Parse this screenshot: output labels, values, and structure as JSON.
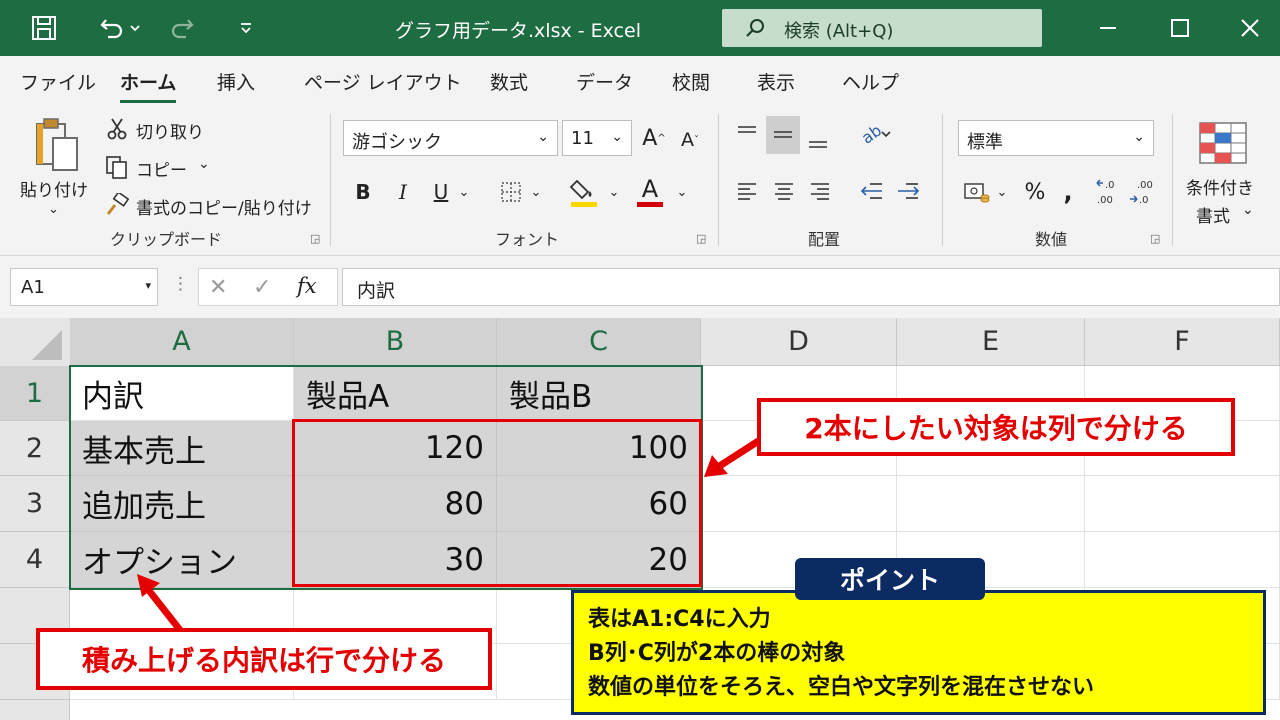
{
  "titlebar": {
    "title": "グラフ用データ.xlsx  -  Excel",
    "search_placeholder": "検索 (Alt+Q)",
    "accent": "#1e6c41"
  },
  "tabs": [
    {
      "label": "ファイル"
    },
    {
      "label": "ホーム"
    },
    {
      "label": "挿入"
    },
    {
      "label": "ページ レイアウト"
    },
    {
      "label": "数式"
    },
    {
      "label": "データ"
    },
    {
      "label": "校閲"
    },
    {
      "label": "表示"
    },
    {
      "label": "ヘルプ"
    }
  ],
  "ribbon": {
    "clipboard": {
      "paste": "貼り付け",
      "cut": "切り取り",
      "copy": "コピー",
      "format_painter": "書式のコピー/貼り付け",
      "group": "クリップボード"
    },
    "font": {
      "name": "游ゴシック",
      "size": "11",
      "group": "フォント",
      "highlight_color": "#ffd800",
      "font_color": "#d40000"
    },
    "alignment": {
      "group": "配置"
    },
    "number": {
      "format": "標準",
      "group": "数値"
    },
    "styles": {
      "conditional": "条件付き",
      "conditional2": "書式"
    }
  },
  "formulabar": {
    "name_box": "A1",
    "fx": "fx",
    "formula": "内訳"
  },
  "sheet": {
    "columns": [
      "A",
      "B",
      "C",
      "D",
      "E",
      "F"
    ],
    "rows": [
      "1",
      "2",
      "3",
      "4"
    ],
    "cells": [
      [
        "内訳",
        "製品A",
        "製品B"
      ],
      [
        "基本売上",
        "120",
        "100"
      ],
      [
        "追加売上",
        "80",
        "60"
      ],
      [
        "オプション",
        "30",
        "20"
      ]
    ]
  },
  "annotations": {
    "callout_columns": "2本にしたい対象は列で分ける",
    "callout_rows": "積み上げる内訳は行で分ける",
    "point_label": "ポイント",
    "point_lines": [
      "表はA1:C4に入力",
      "B列･C列が2本の棒の対象",
      "数値の単位をそろえ、空白や文字列を混在させない"
    ],
    "annotation_color": "#e40000",
    "point_bg": "#ffff00",
    "point_navy": "#0c2b63"
  }
}
